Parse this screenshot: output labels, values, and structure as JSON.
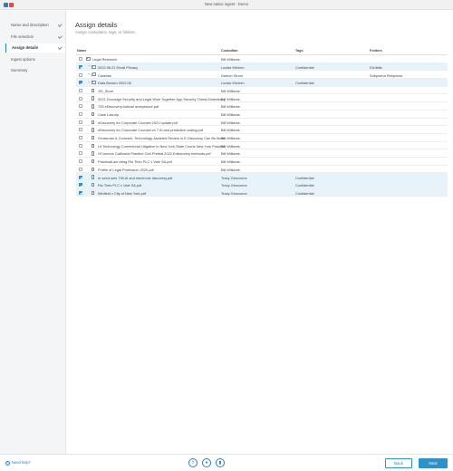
{
  "window": {
    "title": "New native ingest - Demo"
  },
  "sidebar": {
    "steps": [
      {
        "label": "Name and description",
        "done": true
      },
      {
        "label": "File selection",
        "done": true
      },
      {
        "label": "Assign details",
        "done": true,
        "active": true
      },
      {
        "label": "Ingest options",
        "done": false
      },
      {
        "label": "Summary",
        "done": false
      }
    ]
  },
  "main": {
    "title": "Assign details",
    "subtitle": "Assign custodians, tags, or folders.",
    "columns": {
      "name": "Name",
      "custodian": "Custodian",
      "tags": "Tags",
      "folders": "Folders"
    },
    "rows": [
      {
        "name": "Legal Research",
        "type": "folder",
        "depth": 0,
        "expand": "",
        "selected": false,
        "custodian": "Bill Williams",
        "tags": "",
        "folders": ""
      },
      {
        "name": "2022.06.21 Email Privacy",
        "type": "folder",
        "depth": 1,
        "expand": "+",
        "selected": true,
        "custodian": "Louise Kitchen",
        "tags": "Confidential",
        "folders": "Exhibits"
      },
      {
        "name": "Caselaw",
        "type": "folder",
        "depth": 1,
        "expand": "+",
        "selected": false,
        "custodian": "Damon Strom",
        "tags": "",
        "folders": "Subpoena Response"
      },
      {
        "name": "Data Breach 2022.06",
        "type": "folder",
        "depth": 1,
        "expand": "+",
        "selected": true,
        "custodian": "Louise Kitchen",
        "tags": "Confidential",
        "folders": ""
      },
      {
        "name": "JIS_Store",
        "type": "file",
        "depth": 1,
        "expand": "",
        "selected": false,
        "custodian": "Bill Williams",
        "tags": "",
        "folders": ""
      },
      {
        "name": "2021 Docusign Security and Legal Work Together App Security Threat Detection.pdf",
        "type": "file",
        "depth": 1,
        "expand": "",
        "selected": false,
        "custodian": "Bill Williams",
        "tags": "",
        "folders": ""
      },
      {
        "name": "728 eDiscoveryJudicial acceptance.pdf",
        "type": "file",
        "depth": 1,
        "expand": "",
        "selected": false,
        "custodian": "Bill Williams",
        "tags": "",
        "folders": ""
      },
      {
        "name": "Case Law.zip",
        "type": "file",
        "depth": 1,
        "expand": "",
        "selected": false,
        "custodian": "Bill Williams",
        "tags": "",
        "folders": ""
      },
      {
        "name": "eDiscovery for Corporate Counsel 2021 update.pdf",
        "type": "file",
        "depth": 1,
        "expand": "",
        "selected": false,
        "custodian": "Bill Williams",
        "tags": "",
        "folders": ""
      },
      {
        "name": "eDiscovery for Corporate Counsel ch 7 AI and predictive coding.pdf",
        "type": "file",
        "depth": 1,
        "expand": "",
        "selected": false,
        "custodian": "Bill Williams",
        "tags": "",
        "folders": ""
      },
      {
        "name": "Grossman & Cormack, Technology-Assisted Review in E-Discovery Can Be More Effective.pdf",
        "type": "file",
        "depth": 1,
        "expand": "",
        "selected": false,
        "custodian": "Bill Williams",
        "tags": "",
        "folders": ""
      },
      {
        "name": "Lit Technology Commercial Litigation in New York State Courts New York Practice.pdf",
        "type": "file",
        "depth": 1,
        "expand": "",
        "selected": false,
        "custodian": "Bill Williams",
        "tags": "",
        "folders": ""
      },
      {
        "name": "OConnors California Practice Civil Pretrial 2022 Ediscovery methods.pdf",
        "type": "file",
        "depth": 1,
        "expand": "",
        "selected": false,
        "custodian": "Bill Williams",
        "tags": "",
        "folders": ""
      },
      {
        "name": "PracticalLaw citing Rio Tinto PLC v Vale SA.pdf",
        "type": "file",
        "depth": 1,
        "expand": "",
        "selected": false,
        "custodian": "Bill Williams",
        "tags": "",
        "folders": ""
      },
      {
        "name": "Profile of Legal Profession 2020.pdf",
        "type": "file",
        "depth": 1,
        "expand": "",
        "selected": false,
        "custodian": "Bill Williams",
        "tags": "",
        "folders": ""
      },
      {
        "name": "re seed sets 799 AI and electronic discovery.pdf",
        "type": "file",
        "depth": 1,
        "expand": "",
        "selected": true,
        "custodian": "Tracy Geoconne",
        "tags": "Confidential",
        "folders": ""
      },
      {
        "name": "Rio Tinto PLC v Vale SA.pdf",
        "type": "file",
        "depth": 1,
        "expand": "",
        "selected": true,
        "custodian": "Tracy Geoconne",
        "tags": "Confidential",
        "folders": ""
      },
      {
        "name": "Winfield v City of New York.pdf",
        "type": "file",
        "depth": 1,
        "expand": "",
        "selected": true,
        "custodian": "Tracy Geoconne",
        "tags": "Confidential",
        "folders": ""
      }
    ]
  },
  "footer": {
    "help_label": "Need help?",
    "back_label": "Back",
    "next_label": "Next",
    "icons": [
      "upload-icon",
      "tag-icon",
      "folder-icon"
    ]
  },
  "colors": {
    "accent": "#2d92c8",
    "selected_row": "#e7f3fa",
    "link": "#2d7fc1"
  }
}
